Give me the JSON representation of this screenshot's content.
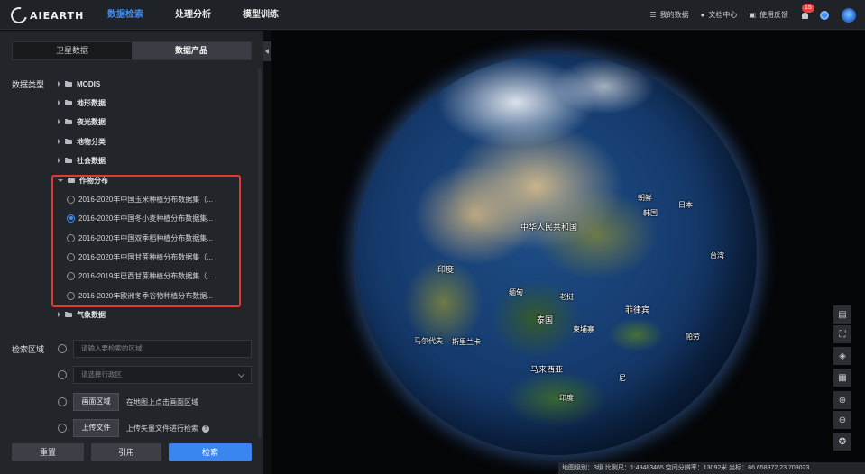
{
  "header": {
    "logo": "AIEARTH",
    "nav": [
      "数据检索",
      "处理分析",
      "模型训练"
    ],
    "active_nav": 0,
    "right": {
      "my_data": "我的数据",
      "docs": "文档中心",
      "feedback": "使用反馈",
      "notification_count": "15"
    }
  },
  "tabs": [
    "卫星数据",
    "数据产品"
  ],
  "active_tab": 1,
  "data_type_label": "数据类型",
  "tree": [
    {
      "label": "MODIS",
      "open": false
    },
    {
      "label": "地形数据",
      "open": false
    },
    {
      "label": "夜光数据",
      "open": false
    },
    {
      "label": "地物分类",
      "open": false
    },
    {
      "label": "社会数据",
      "open": false
    },
    {
      "label": "作物分布",
      "open": true
    },
    {
      "label": "气象数据",
      "open": false
    }
  ],
  "crop_options": [
    {
      "label": "2016-2020年中国玉米种植分布数据集（...",
      "selected": false
    },
    {
      "label": "2016-2020年中国冬小麦种植分布数据集...",
      "selected": true
    },
    {
      "label": "2016-2020年中国双季稻种植分布数据集...",
      "selected": false
    },
    {
      "label": "2016-2020年中国甘蔗种植分布数据集（...",
      "selected": false
    },
    {
      "label": "2016-2019年巴西甘蔗种植分布数据集（...",
      "selected": false
    },
    {
      "label": "2016-2020年欧洲冬季谷物种植分布数据...",
      "selected": false
    }
  ],
  "region": {
    "label": "检索区域",
    "search_placeholder": "请输入要检索的区域",
    "admin_placeholder": "请选择行政区",
    "draw_button": "画面区域",
    "draw_hint": "在地图上点击画面区域",
    "upload_button": "上传文件",
    "upload_hint": "上传矢量文件进行检索"
  },
  "buttons": {
    "reset": "重置",
    "cite": "引用",
    "search": "检索"
  },
  "map_labels": {
    "china": "中华人民共和国",
    "korea_n": "朝鲜",
    "korea_s": "韩国",
    "japan": "日本",
    "india": "印度",
    "myanmar": "缅甸",
    "laos": "老挝",
    "thailand": "泰国",
    "cambodia": "柬埔寨",
    "philippines": "菲律宾",
    "maldives": "马尔代夫",
    "srilanka": "斯里兰卡",
    "malaysia": "马来西亚",
    "palau": "帕劳",
    "indonesia": "印度",
    "ni": "尼",
    "taiwan": "台湾"
  },
  "status_bar": "地图级别：3级   比例尺：1:49483465   空间分辨率：13092米   坐标：86.658872,23.709023",
  "colors": {
    "accent": "#3d8ef7",
    "highlight": "#e03a32"
  }
}
